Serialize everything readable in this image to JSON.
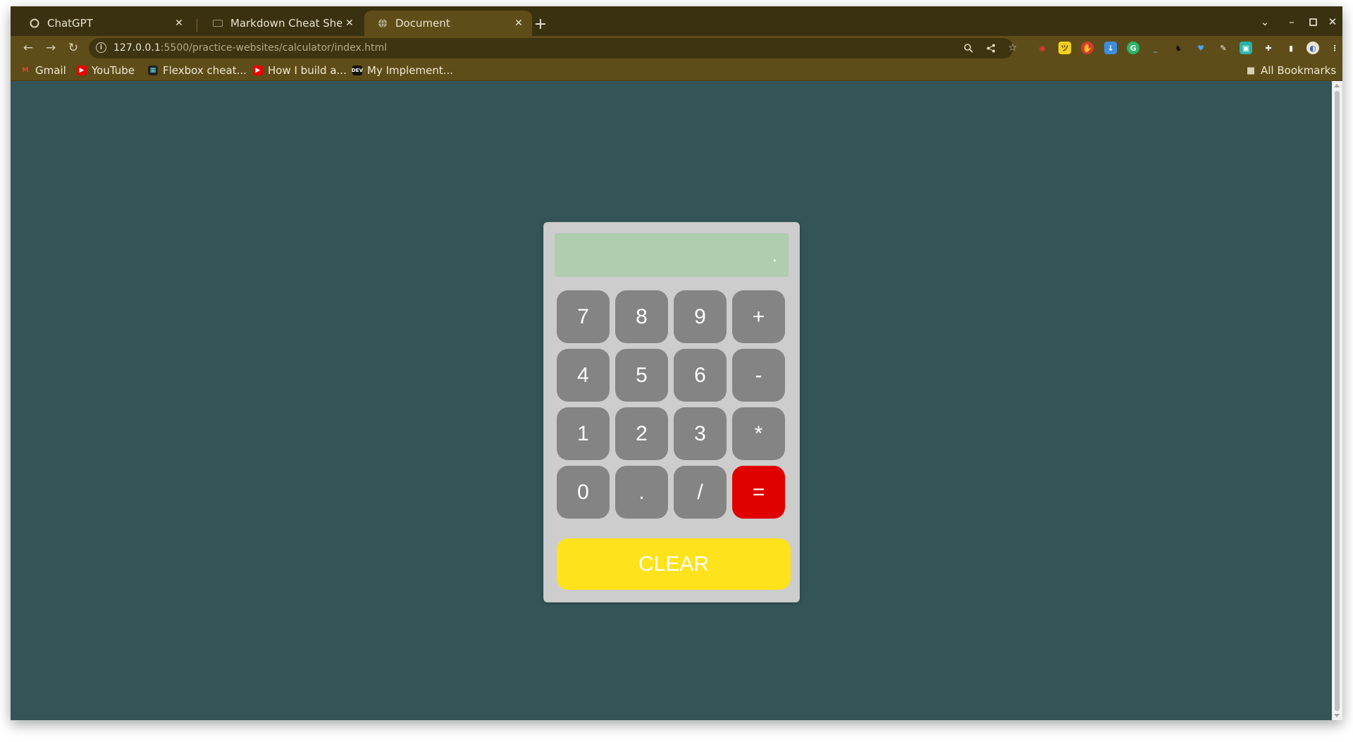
{
  "browser": {
    "tabs": [
      {
        "label": "ChatGPT",
        "icon": "chatgpt-icon"
      },
      {
        "label": "Markdown Cheat Sheet | ",
        "icon": "markdown-icon"
      },
      {
        "label": "Document",
        "icon": "globe-icon",
        "active": true
      }
    ],
    "new_tab": "+",
    "url_host": "127.0.0.1",
    "url_path": ":5500/practice-websites/calculator/index.html",
    "bookmarks": [
      {
        "label": "Gmail",
        "icon": "gmail-icon"
      },
      {
        "label": "YouTube",
        "icon": "youtube-icon"
      },
      {
        "label": "Flexbox cheat...",
        "icon": "flexbox-icon"
      },
      {
        "label": "How I build a...",
        "icon": "youtube-icon"
      },
      {
        "label": "My Implement...",
        "icon": "dev-icon"
      }
    ],
    "all_bookmarks": "All Bookmarks"
  },
  "calculator": {
    "display": ".",
    "keys": [
      "7",
      "8",
      "9",
      "+",
      "4",
      "5",
      "6",
      "-",
      "1",
      "2",
      "3",
      "*",
      "0",
      ".",
      "/",
      "="
    ],
    "clear_label": "CLEAR",
    "colors": {
      "background": "#335557",
      "body": "#cdcdcd",
      "display": "#b0cdb0",
      "key": "#848484",
      "equals": "#e00000",
      "clear": "#fde21c"
    }
  }
}
